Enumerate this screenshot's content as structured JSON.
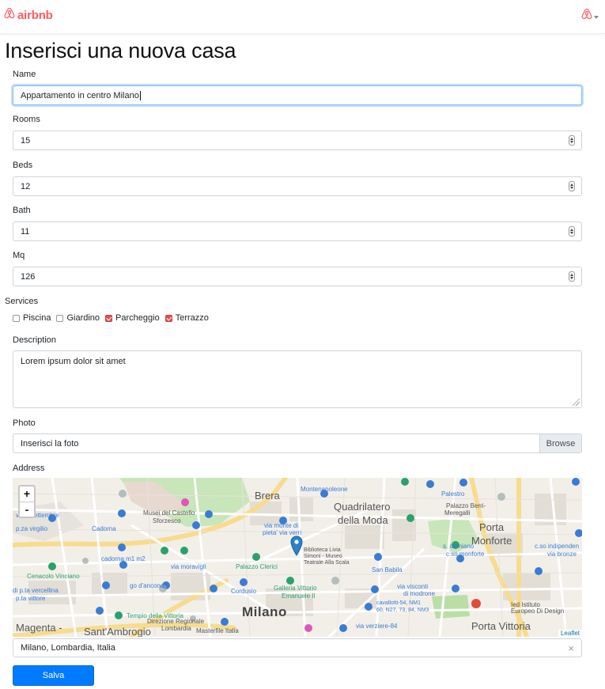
{
  "brand": {
    "name": "airbnb",
    "color": "#ff5a5f"
  },
  "page": {
    "title": "Inserisci una nuova casa"
  },
  "form": {
    "name": {
      "label": "Name",
      "value": "Appartamento in centro Milano"
    },
    "rooms": {
      "label": "Rooms",
      "value": "15"
    },
    "beds": {
      "label": "Beds",
      "value": "12"
    },
    "bath": {
      "label": "Bath",
      "value": "11"
    },
    "mq": {
      "label": "Mq",
      "value": "126"
    },
    "services": {
      "label": "Services",
      "items": [
        {
          "label": "Piscina",
          "checked": false
        },
        {
          "label": "Giardino",
          "checked": false
        },
        {
          "label": "Parcheggio",
          "checked": true
        },
        {
          "label": "Terrazzo",
          "checked": true
        }
      ]
    },
    "description": {
      "label": "Description",
      "value": "Lorem ipsum dolor sit amet"
    },
    "photo": {
      "label": "Photo",
      "placeholder": "Inserisci la foto",
      "button": "Browse"
    },
    "address": {
      "label": "Address",
      "value": "Milano, Lombardia, Italia"
    },
    "submit": "Salva"
  },
  "map": {
    "zoom_in": "+",
    "zoom_out": "-",
    "attribution": "Leaflet",
    "labels": {
      "brera": "Brera",
      "quadrilatero": "Quadrilatero",
      "della_moda": "della Moda",
      "porta_monforte_1": "Porta",
      "porta_monforte_2": "Monforte",
      "milano": "Milano",
      "santambrogio": "Sant'Ambrogio",
      "magenta": "Magenta -",
      "porta_vittoria": "Porta Vittoria",
      "musei": "Musei del Castello",
      "sforzesco": "Sforzesco",
      "cadorna": "Cadorna",
      "galleria_1": "Galleria Vittorio",
      "galleria_2": "Emanuele II",
      "palazzo_clerici": "Palazzo Clerici",
      "cordusio": "Cordusio",
      "san_babila": "San Babila",
      "biblioteca": "Biblioteca Livia",
      "simoni": "Simoni - Museo",
      "teatrale": "Teatrale Alla Scala",
      "montenapoleone": "Montenapoleone",
      "palestro": "Palestro",
      "palazzo_berri": "Palazzo Berri-",
      "meregalli": "Meregalli",
      "cenacolo": "Cenacolo Vinciano",
      "tempio": "Tempio della Vittoria",
      "ied": "Ied Istituto",
      "europeo": "Europeo Di Design",
      "masterfile": "Masterfile Italia",
      "via_verziere": "via verziere-84",
      "direzione": "Direzione Regionale",
      "lombardia": "Lombardia",
      "via_moravigli": "via moravigli",
      "go_ancona": "go d'ancona",
      "cadorna_m1": "cadorna m1 m2",
      "via_vercellina": "di p.ta vercellina",
      "p_vittore": "p.ta vittore",
      "venti_settembre": "venti settembre",
      "p_virgilio": "p.za virgilio",
      "via_monte": "via monte di",
      "pieta": "pieta' via verri",
      "s_damiano": "s. damiano",
      "c_monforte": "c.so monforte",
      "c_indipendenza": "c.so indipenden",
      "via_bronze": "via bronze",
      "via_visconti": "via visconti",
      "di_modrone": "di modrone",
      "cavallotti": "cavallotti-54, NM1",
      "nm2": "60, N27, 73, 84, NM3",
      "pollaiolo": "Pollaiolo Mercato di",
      "cadorna_top": "Cadorna"
    }
  }
}
